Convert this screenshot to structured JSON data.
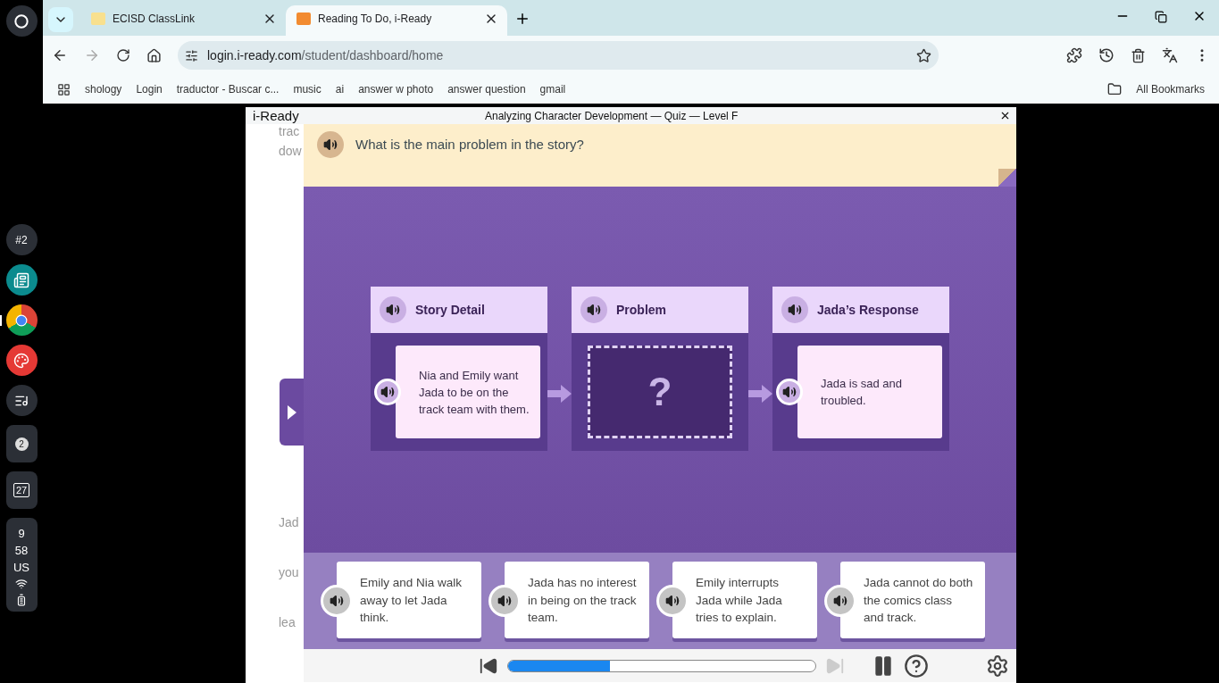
{
  "shelf": {
    "items": [
      {
        "kind": "launcher"
      },
      {
        "kind": "text",
        "label": "#2"
      },
      {
        "kind": "classroom"
      },
      {
        "kind": "chrome",
        "selected": true
      },
      {
        "kind": "paint"
      },
      {
        "kind": "media"
      },
      {
        "kind": "badge",
        "label": "2"
      },
      {
        "kind": "calendar",
        "label": "27"
      }
    ],
    "status": {
      "hour": "9",
      "minute": "58",
      "locale": "US"
    }
  },
  "tabs": [
    {
      "title": "ECISD ClassLink",
      "selected": false
    },
    {
      "title": "Reading To Do, i-Ready",
      "selected": true
    }
  ],
  "address_bar": {
    "host": "login.i-ready.com",
    "path": "/student/dashboard/home"
  },
  "bookmarks": [
    {
      "label": "shology"
    },
    {
      "label": "Login"
    },
    {
      "label": "traductor - Buscar c..."
    },
    {
      "label": "music"
    },
    {
      "label": "ai"
    },
    {
      "label": "answer w photo"
    },
    {
      "label": "answer question"
    },
    {
      "label": "gmail"
    }
  ],
  "all_bookmarks": "All Bookmarks",
  "quiz": {
    "logo": "i-Ready",
    "title": "Analyzing Character Development — Quiz — Level F",
    "background_text": [
      "trac",
      "dow",
      "Jad",
      "you",
      "lea"
    ],
    "question": "What is the main problem in the story?",
    "columns": [
      {
        "heading": "Story Detail",
        "kind": "text",
        "text": "Nia and Emily want Jada to be on the track team with them."
      },
      {
        "heading": "Problem",
        "kind": "blank",
        "text": "?"
      },
      {
        "heading": "Jada’s Response",
        "kind": "text",
        "text": "Jada is sad and troubled."
      }
    ],
    "answers": [
      "Emily and Nia walk away to let Jada think.",
      "Jada has no interest in being on the track team.",
      "Emily interrupts Jada while Jada tries to explain.",
      "Jada cannot do both the comics class and track."
    ],
    "progress": {
      "level": 0.33
    }
  }
}
